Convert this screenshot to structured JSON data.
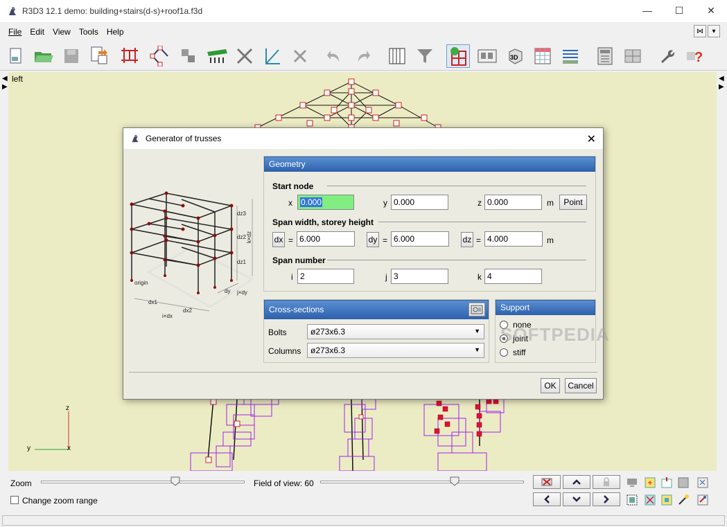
{
  "window": {
    "title": "R3D3 12.1 demo: building+stairs(d-s)+roof1a.f3d",
    "minimize": "—",
    "maximize": "☐",
    "close": "✕"
  },
  "menu": {
    "items": [
      "File",
      "Edit",
      "View",
      "Tools",
      "Help"
    ]
  },
  "viewport": {
    "label": "left",
    "axis_z": "z",
    "axis_y": "y",
    "axis_x": "x"
  },
  "bottom": {
    "zoom_label": "Zoom",
    "fov_label": "Field of view: 60",
    "change_zoom_label": "Change zoom range",
    "zoom_slider_fraction": 0.66,
    "fov_slider_fraction": 0.66
  },
  "dialog": {
    "title": "Generator of trusses",
    "close": "✕",
    "geometry_header": "Geometry",
    "start_node_title": "Start node",
    "x_label": "x",
    "x_value": "0.000",
    "y_label": "y",
    "y_value": "0.000",
    "z_label": "z",
    "z_value": "0.000",
    "m_unit1": "m",
    "point_button": "Point",
    "span_title": "Span width, storey height",
    "dx_button": "dx",
    "dx_eq": "=",
    "dx_value": "6.000",
    "dy_button": "dy",
    "dy_eq": "=",
    "dy_value": "6.000",
    "dz_button": "dz",
    "dz_eq": "=",
    "dz_value": "4.000",
    "m_unit2": "m",
    "span_number_title": "Span number",
    "i_label": "i",
    "i_value": "2",
    "j_label": "j",
    "j_value": "3",
    "k_label": "k",
    "k_value": "4",
    "cross_header": "Cross-sections",
    "bolts_label": "Bolts",
    "bolts_value": "ø273x6.3",
    "columns_label": "Columns",
    "columns_value": "ø273x6.3",
    "support_header": "Support",
    "support_options": [
      "none",
      "joint",
      "stiff"
    ],
    "support_selected": "joint",
    "ok_button": "OK",
    "cancel_button": "Cancel",
    "preview_labels": {
      "dz3": "dz3",
      "dz2": "dz2",
      "dz1": "dz1",
      "kdz": "k×dz",
      "origin": "origin",
      "dy": "dy",
      "jdy": "j×dy",
      "dx1": "dx1",
      "dx2": "dx2",
      "idx": "i×dx"
    }
  },
  "watermark": "SOFTPEDIA",
  "colors": {
    "viewport_bg": "#ececc4",
    "panel_header": "#3a6fbd",
    "node_red": "#cc2222",
    "model_purple": "#a020f0",
    "selection_green": "#80ee80"
  }
}
